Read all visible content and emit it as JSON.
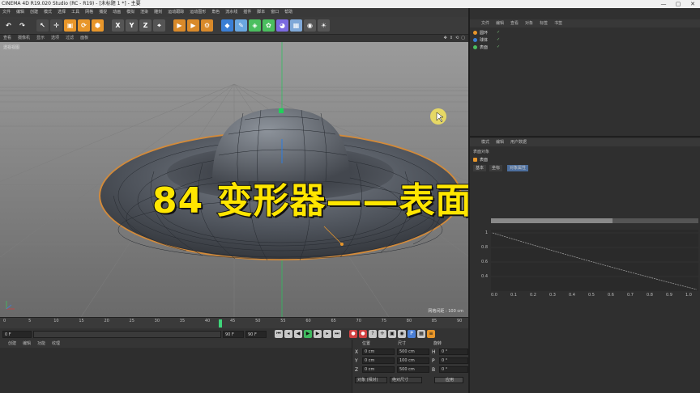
{
  "window": {
    "title": "CINEMA 4D R19.020 Studio (RC - R19) - [未标题 1 *] - 主要",
    "controls": [
      "—",
      "▢",
      "✕"
    ]
  },
  "menubar": {
    "items": [
      "文件",
      "编辑",
      "创建",
      "模式",
      "选择",
      "工具",
      "网格",
      "捕捉",
      "动画",
      "模拟",
      "渲染",
      "雕刻",
      "运动跟踪",
      "运动图形",
      "角色",
      "流水线",
      "插件",
      "脚本",
      "窗口",
      "帮助"
    ]
  },
  "toolbar": {
    "buttons": [
      {
        "name": "undo-icon",
        "glyph": "↶",
        "color": "#3b3b3b"
      },
      {
        "name": "redo-icon",
        "glyph": "↷",
        "color": "#3b3b3b"
      },
      {
        "name": "select-icon",
        "glyph": "↖",
        "color": "#4a4a4a"
      },
      {
        "name": "move-icon",
        "glyph": "✛",
        "color": "#4a4a4a"
      },
      {
        "name": "scale-icon",
        "glyph": "▣",
        "color": "#e8962a"
      },
      {
        "name": "rotate-icon",
        "glyph": "⟳",
        "color": "#e8962a"
      },
      {
        "name": "recent-tool-icon",
        "glyph": "⬢",
        "color": "#e8962a"
      },
      {
        "name": "x-axis-icon",
        "glyph": "X",
        "color": "#555"
      },
      {
        "name": "y-axis-icon",
        "glyph": "Y",
        "color": "#555"
      },
      {
        "name": "z-axis-icon",
        "glyph": "Z",
        "color": "#555"
      },
      {
        "name": "coordinate-system-icon",
        "glyph": "⌖",
        "color": "#555"
      },
      {
        "name": "render-view-icon",
        "glyph": "▶",
        "color": "#d98a2a"
      },
      {
        "name": "render-picture-viewer-icon",
        "glyph": "▶",
        "color": "#d98a2a"
      },
      {
        "name": "render-settings-icon",
        "glyph": "⚙",
        "color": "#d98a2a"
      },
      {
        "name": "cube-icon",
        "glyph": "◆",
        "color": "#3a7fd6"
      },
      {
        "name": "pen-icon",
        "glyph": "✎",
        "color": "#6aa7e0"
      },
      {
        "name": "subdivision-icon",
        "glyph": "◈",
        "color": "#4bbf5f"
      },
      {
        "name": "array-icon",
        "glyph": "✿",
        "color": "#4bbf5f"
      },
      {
        "name": "bend-deformer-icon",
        "glyph": "◕",
        "color": "#7b6ae0"
      },
      {
        "name": "floor-icon",
        "glyph": "▦",
        "color": "#7fa8d8"
      },
      {
        "name": "camera-icon",
        "glyph": "◉",
        "color": "#555"
      },
      {
        "name": "light-icon",
        "glyph": "☀",
        "color": "#555"
      }
    ]
  },
  "viewport": {
    "menu": [
      "查看",
      "摄像机",
      "显示",
      "选项",
      "过滤",
      "面板"
    ],
    "label": "透视视图",
    "info": "网格间距 : 100 cm",
    "overlay_title": "84 变形器——表面"
  },
  "timeline": {
    "ticks": [
      "0",
      "5",
      "10",
      "15",
      "20",
      "25",
      "30",
      "35",
      "40",
      "45",
      "50",
      "55",
      "60",
      "65",
      "70",
      "75",
      "80",
      "85",
      "90"
    ],
    "current_frame": "0 F",
    "start_field": "0 F",
    "min_field": "0 F",
    "end_field": "90 F",
    "max_field": "90 F"
  },
  "material_menu": [
    "创建",
    "编辑",
    "功能",
    "纹理"
  ],
  "coordinates": {
    "headers": [
      "位置",
      "尺寸",
      "旋转"
    ],
    "rows": [
      {
        "axis": "X",
        "pos": "0 cm",
        "size": "500 cm",
        "rot_label": "H",
        "rot": "0 °"
      },
      {
        "axis": "Y",
        "pos": "0 cm",
        "size": "100 cm",
        "rot_label": "P",
        "rot": "0 °"
      },
      {
        "axis": "Z",
        "pos": "0 cm",
        "size": "500 cm",
        "rot_label": "B",
        "rot": "0 °"
      }
    ],
    "mode_select": "对象 (相对)",
    "size_select": "绝对尺寸",
    "apply_button": "应用"
  },
  "object_manager": {
    "tabs": [
      "文件",
      "编辑",
      "查看",
      "对象",
      "标签",
      "书签"
    ],
    "objects": [
      {
        "name": "圆环",
        "color": "#e8962a"
      },
      {
        "name": "球体",
        "color": "#3a7fd6"
      },
      {
        "name": "表面",
        "color": "#4bbf5f"
      }
    ]
  },
  "attributes": {
    "tabs": [
      "模式",
      "编辑",
      "用户数据"
    ],
    "section": "表面对象",
    "object_label": "表面",
    "subtabs": [
      "基本",
      "坐标",
      "对象属性"
    ],
    "graph_y_ticks": [
      "1",
      "0.8",
      "0.6",
      "0.4"
    ],
    "graph_x_ticks": [
      "0.0",
      "0.1",
      "0.2",
      "0.3",
      "0.4",
      "0.5",
      "0.6",
      "0.7",
      "0.8",
      "0.9",
      "1.0"
    ]
  }
}
